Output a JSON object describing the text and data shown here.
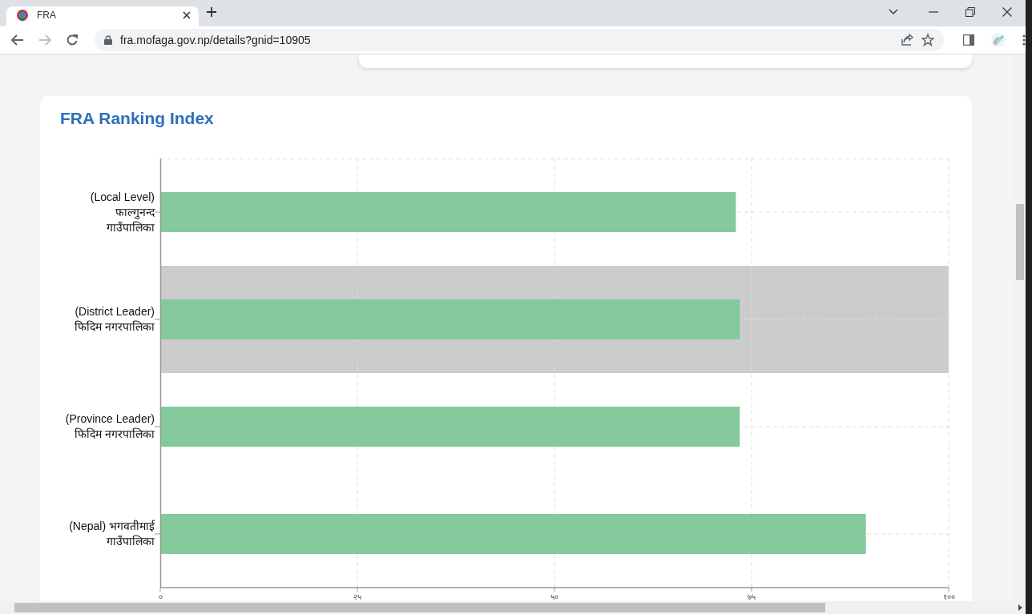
{
  "browser": {
    "tab": {
      "title": "FRA",
      "selected": true
    },
    "address": "fra.mofaga.gov.np/details?gnid=10905"
  },
  "card": {
    "title": "FRA Ranking Index",
    "rank_chart": {
      "highlighted": [
        false,
        true,
        false,
        false
      ],
      "chart_data": {
        "type": "bar",
        "orientation": "horizontal",
        "categories": [
          "(Local Level) फाल्गुनन्द गाउँपालिका",
          "(District Leader) फिदिम नगरपालिका",
          "(Province Leader) फिदिम नगरपालिका",
          "(Nepal) भगवतीमाई गाउँपालिका"
        ],
        "series": [
          {
            "color": "#84c99c",
            "values": [
              73,
              73.5,
              73.5,
              89.5
            ]
          }
        ],
        "xlim": [
          0,
          100
        ],
        "grid": true,
        "xticks": [
          {
            "value": 0,
            "label": "०"
          },
          {
            "value": 25,
            "label": "२५"
          },
          {
            "value": 50,
            "label": "५०"
          },
          {
            "value": 75,
            "label": "७५"
          },
          {
            "value": 100,
            "label": "१००"
          }
        ]
      }
    }
  }
}
